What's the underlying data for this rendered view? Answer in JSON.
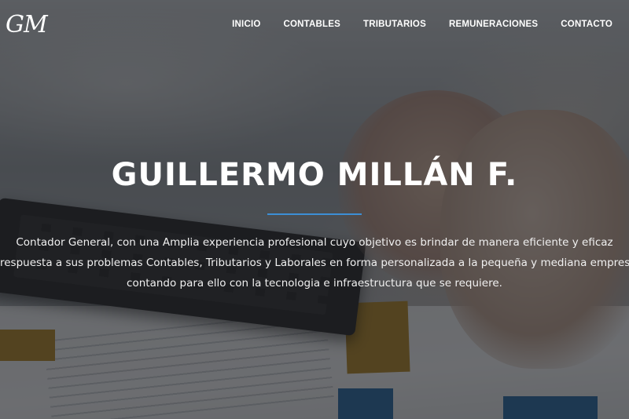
{
  "brand": {
    "logo_text": "GM"
  },
  "nav": {
    "items": [
      {
        "label": "INICIO"
      },
      {
        "label": "CONTABLES"
      },
      {
        "label": "TRIBUTARIOS"
      },
      {
        "label": "REMUNERACIONES"
      },
      {
        "label": "CONTACTO"
      }
    ]
  },
  "hero": {
    "title": "GUILLERMO MILLÁN F.",
    "description_lines": [
      "Contador General, con una Amplia experiencia profesional cuyo objetivo es brindar de manera eficiente y eficaz",
      "respuesta a sus problemas Contables, Tributarios y Laborales en forma personalizada a la pequeña y mediana empresa,",
      "contando para ello con la tecnologia e infraestructura que se requiere."
    ],
    "divider_color": "#3c8fd6"
  },
  "colors": {
    "overlay": "#141618",
    "text": "#ffffff",
    "accent": "#3c8fd6"
  }
}
